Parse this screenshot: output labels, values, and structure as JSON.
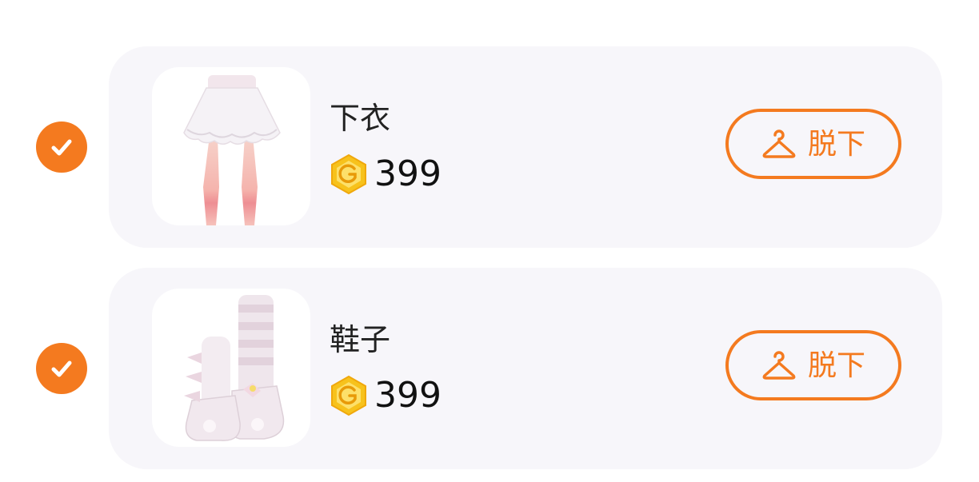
{
  "colors": {
    "accent": "#f47a1f",
    "card_background": "#f7f6fa",
    "coin_gold": "#f7c21c"
  },
  "items": [
    {
      "selected": true,
      "check_icon": "checkmark-circle-icon",
      "image": "skirt-item-image",
      "name": "下衣",
      "currency_icon": "gold-g-coin-icon",
      "price": "399",
      "action_icon": "hanger-icon",
      "action_label": "脱下"
    },
    {
      "selected": true,
      "check_icon": "checkmark-circle-icon",
      "image": "socks-shoes-item-image",
      "name": "鞋子",
      "currency_icon": "gold-g-coin-icon",
      "price": "399",
      "action_icon": "hanger-icon",
      "action_label": "脱下"
    }
  ]
}
